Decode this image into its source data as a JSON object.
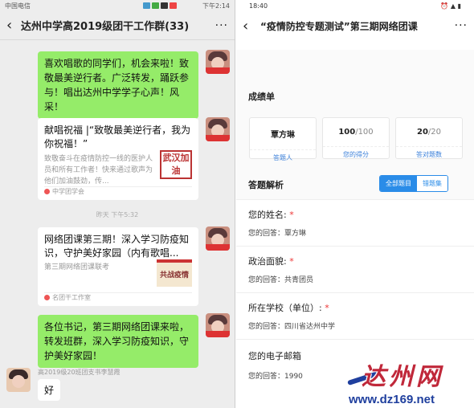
{
  "left": {
    "status": {
      "carrier": "中国电信",
      "time": "下午2:14"
    },
    "nav": {
      "title": "达州中学高2019级团干工作群(33)"
    },
    "messages": [
      {
        "type": "text",
        "text": "喜欢唱歌的同学们，机会来啦！致敬最美逆行者。广泛转发，踊跃参与！唱出达州中学学子心声！风采！"
      },
      {
        "type": "card",
        "title": "献唱祝福 |“致敬最美逆行者，我为你祝福！”",
        "desc": "致敬奋斗在疫情防控一线的医护人员和所有工作者！快来通过歌声为他们加油鼓劲，传...",
        "source": "中学团学会",
        "thumb_text": "武汉加油"
      },
      {
        "type": "card",
        "title": "网络团课第三期！深入学习防疫知识，守护美好家园（内有歌唱...",
        "desc": "第三期网络团课联考",
        "source": "名团干工作室",
        "thumb_text": "共战疫情"
      },
      {
        "type": "text",
        "text": "各位书记，第三期网络团课来啦，转发班群，深入学习防疫知识，守护美好家园！"
      }
    ],
    "time_separator": "昨天 下午5:32",
    "sender_name": "高2019级20班团支书李慧霞",
    "reply": "好"
  },
  "right": {
    "status": {
      "time": "18:40"
    },
    "nav": {
      "title": "“疫情防控专题测试”第三期网络团课"
    },
    "scorecard_title": "成绩单",
    "scores": [
      {
        "value": "覃方琳",
        "total": "",
        "label": "答题人"
      },
      {
        "value": "100",
        "total": "/100",
        "label": "您的得分"
      },
      {
        "value": "20",
        "total": "/20",
        "label": "答对题数"
      }
    ],
    "analysis_title": "答题解析",
    "tabs": [
      {
        "label": "全部题目",
        "active": true
      },
      {
        "label": "错题集",
        "active": false
      }
    ],
    "questions": [
      {
        "q": "您的姓名:",
        "a": "您的回答：覃方琳"
      },
      {
        "q": "政治面貌:",
        "a": "您的回答：共青团员"
      },
      {
        "q": "所在学校（单位）:",
        "a": "您的回答：四川省达州中学"
      },
      {
        "q": "您的电子邮箱",
        "a": "您的回答：1990"
      }
    ]
  },
  "watermark": {
    "cn": "达州网",
    "url": "www.dz169.net"
  },
  "colors": {
    "wechat_green": "#95ec69",
    "accent_blue": "#2a8ce8",
    "required_red": "#e33",
    "watermark_red": "#c0283a",
    "watermark_blue": "#1f3f9e"
  }
}
